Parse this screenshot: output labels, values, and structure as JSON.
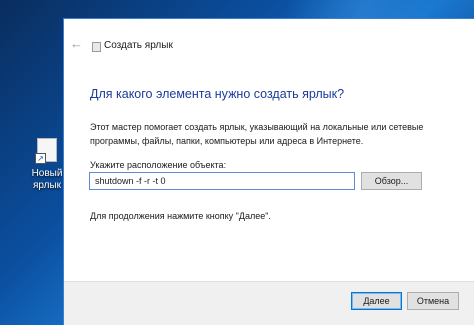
{
  "desktop": {
    "shortcut_label": "Новый ярлык"
  },
  "window": {
    "title": "Создать ярлык",
    "back_glyph": "←",
    "heading": "Для какого элемента нужно создать ярлык?",
    "description": "Этот мастер помогает создать ярлык, указывающий на локальные или сетевые программы, файлы, папки, компьютеры или адреса в Интернете.",
    "location_label": "Укажите расположение объекта:",
    "location_value": "shutdown -f -r -t 0",
    "browse_label": "Обзор...",
    "continue_hint": "Для продолжения нажмите кнопку \"Далее\".",
    "next_label": "Далее",
    "cancel_label": "Отмена"
  },
  "colors": {
    "accent": "#0078d7",
    "heading": "#1a3b9c",
    "desktop_background": "#0b4fa0"
  },
  "icons": {
    "back": "arrow-left-icon",
    "title": "shortcut-icon",
    "desktop": "new-shortcut-icon"
  }
}
